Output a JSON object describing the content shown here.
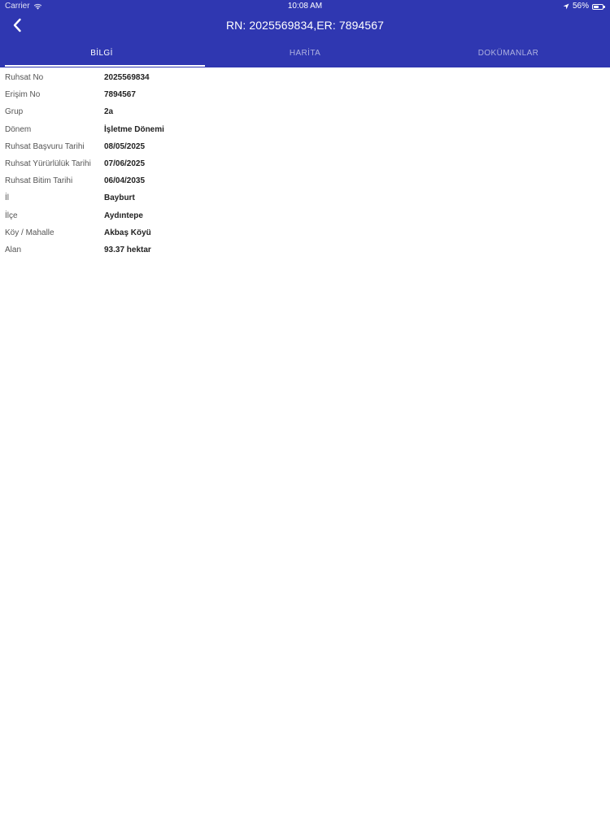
{
  "status_bar": {
    "carrier": "Carrier",
    "time": "10:08 AM",
    "battery": "56%",
    "battery_level": 0.56
  },
  "nav": {
    "back_icon": "chevron-left-icon",
    "title": "RN: 2025569834,ER: 7894567"
  },
  "tabs": [
    {
      "label": "BİLGİ",
      "active": true
    },
    {
      "label": "HARİTA",
      "active": false
    },
    {
      "label": "DOKÜMANLAR",
      "active": false
    }
  ],
  "details": [
    {
      "label": "Ruhsat No",
      "value": "2025569834"
    },
    {
      "label": "Erişim No",
      "value": "7894567"
    },
    {
      "label": "Grup",
      "value": "2a"
    },
    {
      "label": "Dönem",
      "value": "İşletme Dönemi"
    },
    {
      "label": "Ruhsat Başvuru Tarihi",
      "value": "08/05/2025"
    },
    {
      "label": "Ruhsat Yürürlülük Tarihi",
      "value": "07/06/2025"
    },
    {
      "label": "Ruhsat Bitim Tarihi",
      "value": "06/04/2035"
    },
    {
      "label": "İl",
      "value": "Bayburt"
    },
    {
      "label": "İlçe",
      "value": "Aydıntepe"
    },
    {
      "label": "Köy / Mahalle",
      "value": "Akbaş Köyü"
    },
    {
      "label": "Alan",
      "value": "93.37 hektar"
    }
  ],
  "colors": {
    "header": "#2f37b1",
    "background": "#ffffff"
  }
}
